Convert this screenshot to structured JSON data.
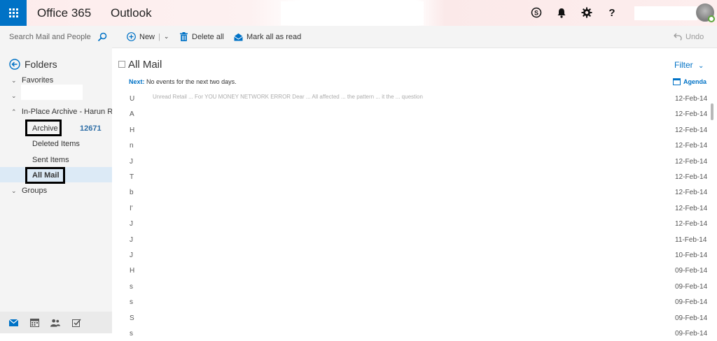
{
  "header": {
    "brand": "Office 365",
    "app": "Outlook",
    "icons": [
      "skype-icon",
      "bell-icon",
      "gear-icon",
      "help-icon"
    ],
    "help_glyph": "?"
  },
  "sidebar": {
    "search_placeholder": "Search Mail and People",
    "folders_label": "Folders",
    "favorites_label": "Favorites",
    "archive_group_label": "In-Place Archive - Harun Rus",
    "items": [
      {
        "label": "Archive",
        "count": "12671"
      },
      {
        "label": "Deleted Items"
      },
      {
        "label": "Sent Items"
      },
      {
        "label": "All Mail"
      }
    ],
    "groups_label": "Groups"
  },
  "toolbar": {
    "new_label": "New",
    "delete_label": "Delete all",
    "mark_read_label": "Mark all as read",
    "undo_label": "Undo"
  },
  "main": {
    "title": "All Mail",
    "filter_label": "Filter",
    "next_label": "Next:",
    "next_text": "No events for the next two days.",
    "agenda_label": "Agenda",
    "first_row_text": "Unread  Retail ...  For YOU MONEY NETWORK ERROR  Dear  ... All affected  ... the pattern  ... it the  ... question",
    "messages": [
      {
        "letter": "U",
        "date": "12-Feb-14"
      },
      {
        "letter": "A",
        "date": "12-Feb-14"
      },
      {
        "letter": "H",
        "date": "12-Feb-14"
      },
      {
        "letter": "n",
        "date": "12-Feb-14"
      },
      {
        "letter": "J",
        "date": "12-Feb-14"
      },
      {
        "letter": "T",
        "date": "12-Feb-14"
      },
      {
        "letter": "b",
        "date": "12-Feb-14"
      },
      {
        "letter": "I'",
        "date": "12-Feb-14"
      },
      {
        "letter": "J",
        "date": "12-Feb-14"
      },
      {
        "letter": "J",
        "date": "11-Feb-14"
      },
      {
        "letter": "J",
        "date": "10-Feb-14"
      },
      {
        "letter": "H",
        "date": "09-Feb-14"
      },
      {
        "letter": "s",
        "date": "09-Feb-14"
      },
      {
        "letter": "s",
        "date": "09-Feb-14"
      },
      {
        "letter": "S",
        "date": "09-Feb-14"
      },
      {
        "letter": "s",
        "date": "09-Feb-14"
      }
    ]
  },
  "colors": {
    "accent": "#0072c6",
    "highlight_border": "#000000",
    "selected_bg": "#dceaf6"
  }
}
